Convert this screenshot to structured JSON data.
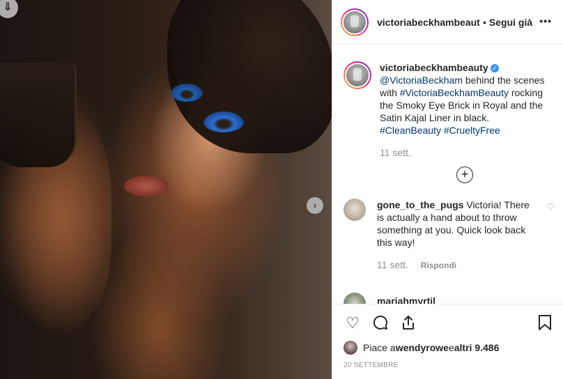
{
  "post": {
    "username": "victoriabeckhambeauty",
    "follow_separator": "•",
    "follow_label": "Segui già",
    "more_label": "•••",
    "caption": {
      "username": "victoriabeckhambeauty",
      "mention": "@VictoriaBeckham",
      "text1": " behind the scenes with ",
      "hashtag1": "#VictoriaBeckhamBeauty",
      "text2": " rocking the Smoky Eye Brick in Royal and the Satin Kajal Liner in black. ",
      "hashtag2": "#CleanBeauty",
      "hashtag3": "#CrueltyFree",
      "time": "11 sett."
    },
    "load_more_label": "+"
  },
  "comments": [
    {
      "username": "gone_to_the_pugs",
      "text": " Victoria! There is actually a hand about to throw something at you. Quick look back this way!",
      "time": "11 sett.",
      "reply_label": "Rispondi"
    },
    {
      "username": "mariahmyrtil"
    }
  ],
  "likes": {
    "prefix": "Piace a ",
    "user": "wendyrowe",
    "middle": " e ",
    "count": "altri 9.486"
  },
  "date": "20 SETTEMBRE",
  "icons": {
    "download": "download-icon",
    "next": "chevron-right-icon",
    "like": "heart-icon",
    "comment": "comment-icon",
    "share": "share-icon",
    "save": "bookmark-icon"
  },
  "colors": {
    "link": "#00376b",
    "verified": "#3897f0",
    "muted": "#8e8e8e"
  }
}
